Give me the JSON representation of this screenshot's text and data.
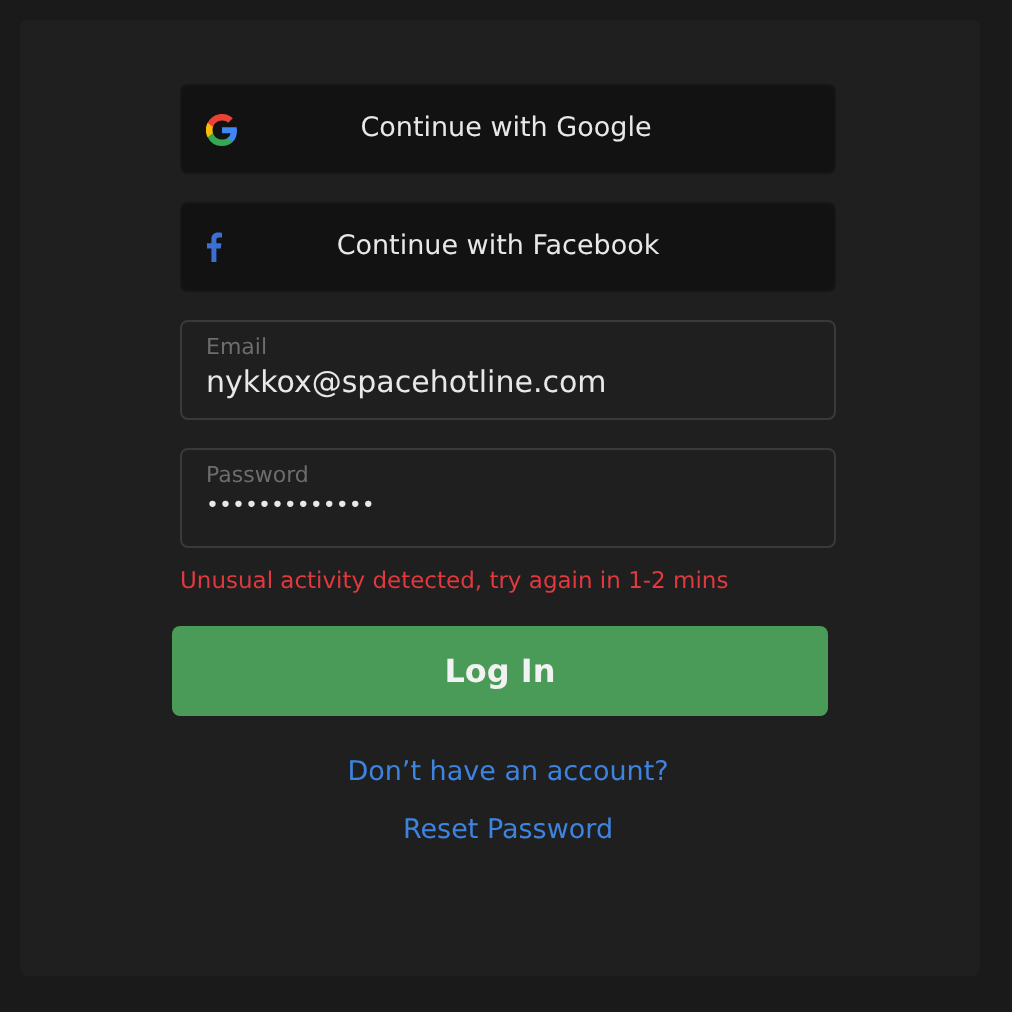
{
  "social_buttons": [
    {
      "kind": "google",
      "label": "Continue with Google"
    },
    {
      "kind": "facebook",
      "label": "Continue with Facebook"
    }
  ],
  "fields": [
    {
      "label": "Email",
      "value": "nykkox@spacehotline.com"
    },
    {
      "label": "Password",
      "value": "•••••••••••••"
    }
  ],
  "error": "Unusual activity detected, try again in 1-2 mins",
  "login_button": "Log In",
  "links": [
    "Don’t have an account?",
    "Reset Password"
  ]
}
